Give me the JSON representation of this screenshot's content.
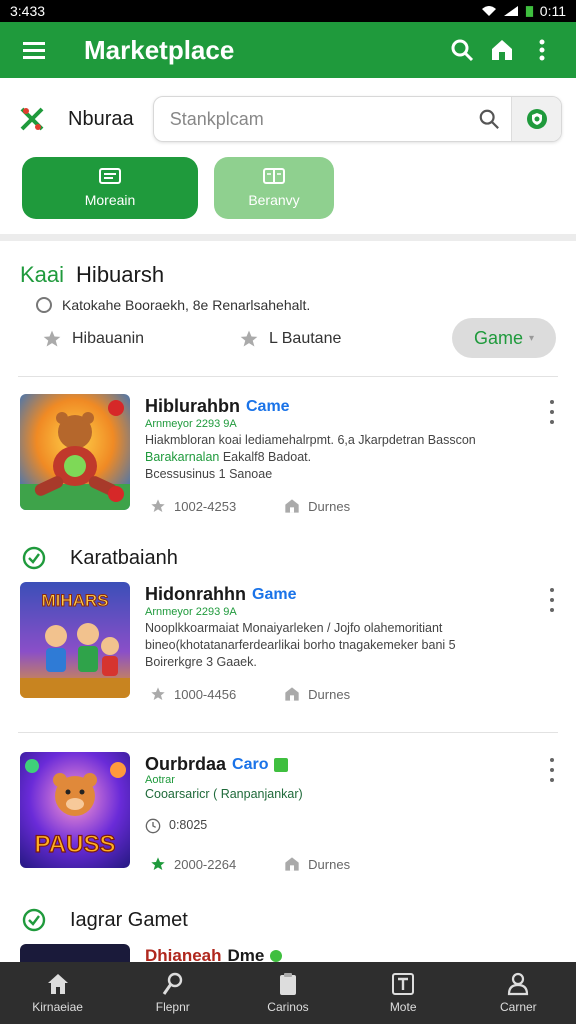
{
  "status_bar": {
    "time": "3:433",
    "right_time": "0:11"
  },
  "app_bar": {
    "title": "Marketplace",
    "icons": [
      "menu-icon",
      "search-icon",
      "home-icon",
      "more-vert-icon"
    ]
  },
  "search_row": {
    "brand": "Nburaa",
    "placeholder": "Stankplcam",
    "icons": [
      "logo-x-icon",
      "search-icon",
      "shield-icon"
    ]
  },
  "tabs": [
    {
      "label": "Moreain",
      "icon": "news-icon"
    },
    {
      "label": "Beranvy",
      "icon": "book-icon"
    }
  ],
  "filter": {
    "title_key": "Kaai",
    "title": "Hibuarsh",
    "radio_label": "Katokahe Booraekh, 8e Renarlsahehalt.",
    "options": [
      "Hibauanin",
      "L Bautane"
    ],
    "chip_label": "Game"
  },
  "apps": [
    {
      "name": "Hiblurahbn",
      "tag": "Came",
      "sub": "Arnmeyor 2293 9A",
      "desc_line1": "Hiakmbloran koai lediamehalrpmt. 6,a Jkarpdetran Basscon",
      "desc_line2_green": "Barakarnalan",
      "desc_line2": " Eakalf8 Badoat.",
      "desc_line3": "Bcessusinus 1 Sanoae",
      "rating": "1002-4253",
      "store": "Durnes",
      "art_title": "",
      "colors": {
        "bg1": "#f08a24",
        "bg2": "#2a72c8"
      }
    },
    {
      "name": "Hidonrahhn",
      "tag": "Game",
      "sub": "Arnmeyor 2293 9A",
      "desc_line1": "Nooplkkoarmaiat Monaiyarleken / Jojfo olahemoritiant",
      "desc_line2_green": "",
      "desc_line2": "bineo(khotatanarferdearlikai borho tnagakemeker bani 5",
      "desc_line3": "Boirerkgre 3 Gaaek.",
      "rating": "1000-4456",
      "store": "Durnes",
      "art_title": "MIHARS",
      "colors": {
        "bg1": "#3b4fb8",
        "bg2": "#e8a020"
      }
    },
    {
      "name": "Ourbrdaa",
      "tag": "Caro",
      "sub": "Aotrar",
      "desc_line1": "Cooarsaricr ( Ranpanjankar)",
      "desc_line2_green": "",
      "desc_line2": "0:8025",
      "desc_line3": "",
      "rating": "2000-2264",
      "store": "Durnes",
      "art_title": "PAUSS",
      "colors": {
        "bg1": "#6a2bd8",
        "bg2": "#ff9a3c"
      }
    }
  ],
  "sections": [
    "Karatbaianh",
    "Iagrar Gamet"
  ],
  "peek_item": {
    "name": "Dhianeah",
    "tag": "Dme"
  },
  "bottom_nav": [
    {
      "label": "Kirnaeiae",
      "icon": "home-icon"
    },
    {
      "label": "Flepnr",
      "icon": "wrench-icon"
    },
    {
      "label": "Carinos",
      "icon": "clipboard-icon"
    },
    {
      "label": "Mote",
      "icon": "text-box-icon"
    },
    {
      "label": "Carner",
      "icon": "person-icon"
    }
  ],
  "colors": {
    "brand_green": "#1f9a3c",
    "light_green": "#8fd08f",
    "blue_tag": "#1a73e8"
  }
}
